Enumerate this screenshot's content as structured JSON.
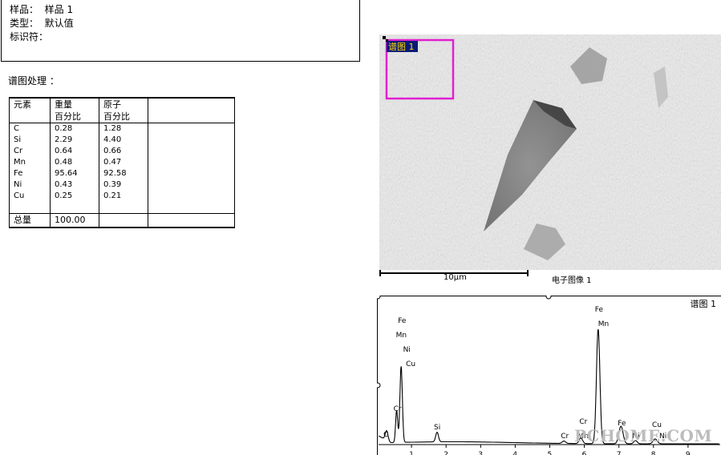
{
  "sample_info": {
    "sample_label": "样品：",
    "sample_value": "样品 1",
    "type_label": "类型：",
    "type_value": "默认值",
    "id_label": "标识符："
  },
  "spectrum_processing": "谱图处理 ：",
  "table": {
    "col1": "元素",
    "col2": "重量",
    "col3": "原子",
    "col2_sub": "百分比",
    "col3_sub": "百分比",
    "rows": [
      {
        "element": "C",
        "weight": "0.28",
        "atomic": "1.28"
      },
      {
        "element": "Si",
        "weight": "2.29",
        "atomic": "4.40"
      },
      {
        "element": "Cr",
        "weight": "0.64",
        "atomic": "0.66"
      },
      {
        "element": "Mn",
        "weight": "0.48",
        "atomic": "0.47"
      },
      {
        "element": "Fe",
        "weight": "95.64",
        "atomic": "92.58"
      },
      {
        "element": "Ni",
        "weight": "0.43",
        "atomic": "0.39"
      },
      {
        "element": "Cu",
        "weight": "0.25",
        "atomic": "0.21"
      }
    ],
    "total_label": "总量",
    "total_value": "100.00"
  },
  "image": {
    "roi_label": "谱图 1",
    "scale_label": "10µm",
    "caption": "电子图像 1",
    "roi_color": "#e020d0"
  },
  "spectrum": {
    "title": "谱图 1",
    "peak_labels": [
      {
        "text": "Fe",
        "x": 0.7
      },
      {
        "text": "Mn",
        "x": 0.64
      },
      {
        "text": "Ni",
        "x": 0.85
      },
      {
        "text": "Cu",
        "x": 0.93
      },
      {
        "text": "Cr",
        "x": 0.57
      },
      {
        "text": "C",
        "x": 0.28
      },
      {
        "text": "Si",
        "x": 1.74
      },
      {
        "text": "Cr",
        "x": 5.41
      },
      {
        "text": "Cr",
        "x": 5.95
      },
      {
        "text": "Mn",
        "x": 5.9
      },
      {
        "text": "Fe",
        "x": 6.4
      },
      {
        "text": "Mn",
        "x": 6.49
      },
      {
        "text": "Fe",
        "x": 7.06
      },
      {
        "text": "Ni",
        "x": 7.48
      },
      {
        "text": "Cu",
        "x": 8.05
      },
      {
        "text": "Ni",
        "x": 8.26
      }
    ],
    "ticks": [
      "1",
      "2",
      "3",
      "4",
      "5",
      "6",
      "7",
      "8",
      "9"
    ]
  },
  "watermark": "PCHOME.COM"
}
